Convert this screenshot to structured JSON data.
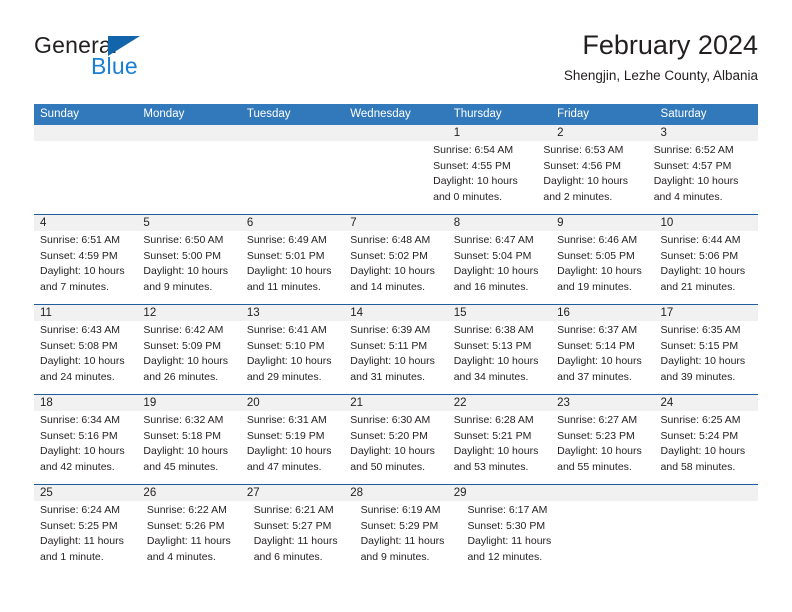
{
  "brand": {
    "name_top": "General",
    "name_bottom": "Blue",
    "triangle_color": "#1265ab",
    "blue_text_color": "#1a7fd4"
  },
  "header": {
    "title": "February 2024",
    "location": "Shengjin, Lezhe County, Albania"
  },
  "theme": {
    "header_row_background": "#3279bb",
    "header_row_text": "#ffffff",
    "week_divider": "#1f5d9c",
    "date_band_background": "#f1f1f1",
    "cell_background": "#ffffff",
    "text": "#231f20"
  },
  "weekdays": [
    "Sunday",
    "Monday",
    "Tuesday",
    "Wednesday",
    "Thursday",
    "Friday",
    "Saturday"
  ],
  "weeks": [
    [
      {
        "day": "",
        "lines": []
      },
      {
        "day": "",
        "lines": []
      },
      {
        "day": "",
        "lines": []
      },
      {
        "day": "",
        "lines": []
      },
      {
        "day": "1",
        "lines": [
          "Sunrise: 6:54 AM",
          "Sunset: 4:55 PM",
          "Daylight: 10 hours",
          "and 0 minutes."
        ]
      },
      {
        "day": "2",
        "lines": [
          "Sunrise: 6:53 AM",
          "Sunset: 4:56 PM",
          "Daylight: 10 hours",
          "and 2 minutes."
        ]
      },
      {
        "day": "3",
        "lines": [
          "Sunrise: 6:52 AM",
          "Sunset: 4:57 PM",
          "Daylight: 10 hours",
          "and 4 minutes."
        ]
      }
    ],
    [
      {
        "day": "4",
        "lines": [
          "Sunrise: 6:51 AM",
          "Sunset: 4:59 PM",
          "Daylight: 10 hours",
          "and 7 minutes."
        ]
      },
      {
        "day": "5",
        "lines": [
          "Sunrise: 6:50 AM",
          "Sunset: 5:00 PM",
          "Daylight: 10 hours",
          "and 9 minutes."
        ]
      },
      {
        "day": "6",
        "lines": [
          "Sunrise: 6:49 AM",
          "Sunset: 5:01 PM",
          "Daylight: 10 hours",
          "and 11 minutes."
        ]
      },
      {
        "day": "7",
        "lines": [
          "Sunrise: 6:48 AM",
          "Sunset: 5:02 PM",
          "Daylight: 10 hours",
          "and 14 minutes."
        ]
      },
      {
        "day": "8",
        "lines": [
          "Sunrise: 6:47 AM",
          "Sunset: 5:04 PM",
          "Daylight: 10 hours",
          "and 16 minutes."
        ]
      },
      {
        "day": "9",
        "lines": [
          "Sunrise: 6:46 AM",
          "Sunset: 5:05 PM",
          "Daylight: 10 hours",
          "and 19 minutes."
        ]
      },
      {
        "day": "10",
        "lines": [
          "Sunrise: 6:44 AM",
          "Sunset: 5:06 PM",
          "Daylight: 10 hours",
          "and 21 minutes."
        ]
      }
    ],
    [
      {
        "day": "11",
        "lines": [
          "Sunrise: 6:43 AM",
          "Sunset: 5:08 PM",
          "Daylight: 10 hours",
          "and 24 minutes."
        ]
      },
      {
        "day": "12",
        "lines": [
          "Sunrise: 6:42 AM",
          "Sunset: 5:09 PM",
          "Daylight: 10 hours",
          "and 26 minutes."
        ]
      },
      {
        "day": "13",
        "lines": [
          "Sunrise: 6:41 AM",
          "Sunset: 5:10 PM",
          "Daylight: 10 hours",
          "and 29 minutes."
        ]
      },
      {
        "day": "14",
        "lines": [
          "Sunrise: 6:39 AM",
          "Sunset: 5:11 PM",
          "Daylight: 10 hours",
          "and 31 minutes."
        ]
      },
      {
        "day": "15",
        "lines": [
          "Sunrise: 6:38 AM",
          "Sunset: 5:13 PM",
          "Daylight: 10 hours",
          "and 34 minutes."
        ]
      },
      {
        "day": "16",
        "lines": [
          "Sunrise: 6:37 AM",
          "Sunset: 5:14 PM",
          "Daylight: 10 hours",
          "and 37 minutes."
        ]
      },
      {
        "day": "17",
        "lines": [
          "Sunrise: 6:35 AM",
          "Sunset: 5:15 PM",
          "Daylight: 10 hours",
          "and 39 minutes."
        ]
      }
    ],
    [
      {
        "day": "18",
        "lines": [
          "Sunrise: 6:34 AM",
          "Sunset: 5:16 PM",
          "Daylight: 10 hours",
          "and 42 minutes."
        ]
      },
      {
        "day": "19",
        "lines": [
          "Sunrise: 6:32 AM",
          "Sunset: 5:18 PM",
          "Daylight: 10 hours",
          "and 45 minutes."
        ]
      },
      {
        "day": "20",
        "lines": [
          "Sunrise: 6:31 AM",
          "Sunset: 5:19 PM",
          "Daylight: 10 hours",
          "and 47 minutes."
        ]
      },
      {
        "day": "21",
        "lines": [
          "Sunrise: 6:30 AM",
          "Sunset: 5:20 PM",
          "Daylight: 10 hours",
          "and 50 minutes."
        ]
      },
      {
        "day": "22",
        "lines": [
          "Sunrise: 6:28 AM",
          "Sunset: 5:21 PM",
          "Daylight: 10 hours",
          "and 53 minutes."
        ]
      },
      {
        "day": "23",
        "lines": [
          "Sunrise: 6:27 AM",
          "Sunset: 5:23 PM",
          "Daylight: 10 hours",
          "and 55 minutes."
        ]
      },
      {
        "day": "24",
        "lines": [
          "Sunrise: 6:25 AM",
          "Sunset: 5:24 PM",
          "Daylight: 10 hours",
          "and 58 minutes."
        ]
      }
    ],
    [
      {
        "day": "25",
        "lines": [
          "Sunrise: 6:24 AM",
          "Sunset: 5:25 PM",
          "Daylight: 11 hours",
          "and 1 minute."
        ]
      },
      {
        "day": "26",
        "lines": [
          "Sunrise: 6:22 AM",
          "Sunset: 5:26 PM",
          "Daylight: 11 hours",
          "and 4 minutes."
        ]
      },
      {
        "day": "27",
        "lines": [
          "Sunrise: 6:21 AM",
          "Sunset: 5:27 PM",
          "Daylight: 11 hours",
          "and 6 minutes."
        ]
      },
      {
        "day": "28",
        "lines": [
          "Sunrise: 6:19 AM",
          "Sunset: 5:29 PM",
          "Daylight: 11 hours",
          "and 9 minutes."
        ]
      },
      {
        "day": "29",
        "lines": [
          "Sunrise: 6:17 AM",
          "Sunset: 5:30 PM",
          "Daylight: 11 hours",
          "and 12 minutes."
        ]
      },
      {
        "day": "",
        "lines": []
      },
      {
        "day": "",
        "lines": []
      }
    ]
  ]
}
